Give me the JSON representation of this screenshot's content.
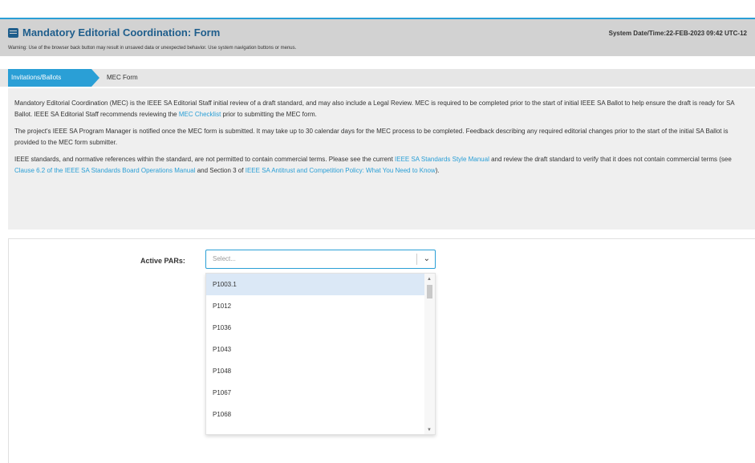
{
  "header": {
    "title": "Mandatory Editorial Coordination: Form",
    "warning": "Warning: Use of the browser back button may result in unsaved data or unexpected behavior. Use system navigation buttons or menus.",
    "system_date": "System Date/Time:22-FEB-2023 09:42 UTC-12"
  },
  "breadcrumb": {
    "active": "Invitations/Ballots",
    "current": "MEC Form"
  },
  "info": {
    "p1_a": "Mandatory Editorial Coordination (MEC) is the IEEE SA Editorial Staff initial review of a draft standard, and may also include a Legal Review. MEC is required to be completed prior to the start of initial IEEE SA Ballot to help ensure the draft is ready for SA Ballot. IEEE SA Editorial Staff recommends reviewing the ",
    "p1_link": "MEC Checklist",
    "p1_b": " prior to submitting the MEC form.",
    "p2": "The project's IEEE SA Program Manager is notified once the MEC form is submitted. It may take up to 30 calendar days for the MEC process to be completed. Feedback describing any required editorial changes prior to the start of the initial SA Ballot is provided to the MEC form submitter.",
    "p3_a": "IEEE standards, and normative references within the standard, are not permitted to contain commercial terms. Please see the current ",
    "p3_link1": "IEEE SA Standards Style Manual",
    "p3_b": " and review the draft standard to verify that it does not contain commercial terms (see ",
    "p3_link2": "Clause 6.2 of the IEEE SA Standards Board Operations Manual",
    "p3_c": " and Section 3 of ",
    "p3_link3": "IEEE SA Antitrust and Competition Policy: What You Need to Know",
    "p3_d": ")."
  },
  "form": {
    "active_pars_label": "Active PARs:",
    "select_placeholder": "Select...",
    "options": [
      "P1003.1",
      "P1012",
      "P1036",
      "P1043",
      "P1048",
      "P1067",
      "P1068"
    ]
  },
  "colors": {
    "accent": "#2a9fd6",
    "header_bg": "#d2d2d2",
    "title": "#1f5e8c",
    "highlight": "#dbe8f6"
  }
}
